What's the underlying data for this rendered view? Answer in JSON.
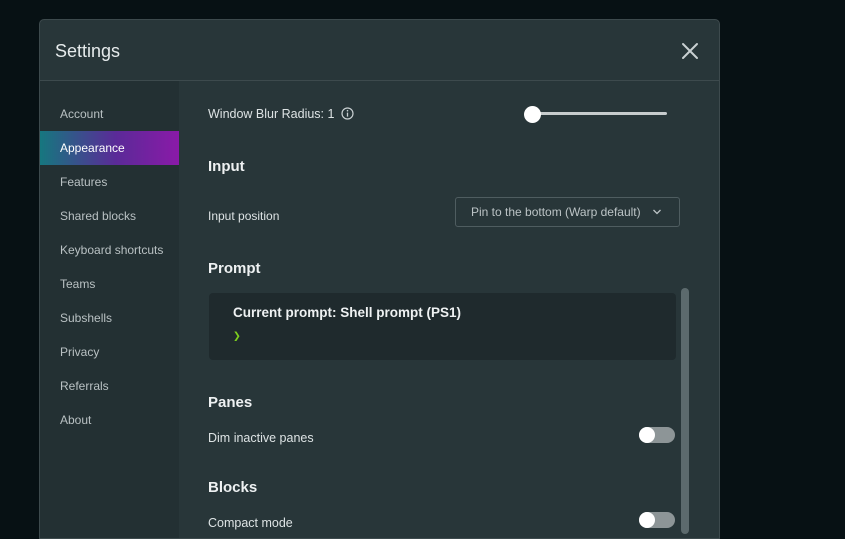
{
  "window": {
    "title": "Settings"
  },
  "sidebar": {
    "items": [
      {
        "label": "Account"
      },
      {
        "label": "Appearance"
      },
      {
        "label": "Features"
      },
      {
        "label": "Shared blocks"
      },
      {
        "label": "Keyboard shortcuts"
      },
      {
        "label": "Teams"
      },
      {
        "label": "Subshells"
      },
      {
        "label": "Privacy"
      },
      {
        "label": "Referrals"
      },
      {
        "label": "About"
      }
    ],
    "active": "Appearance",
    "active_gradient": [
      "#16777f",
      "#8a1aa8"
    ]
  },
  "appearance": {
    "window_blur": {
      "label": "Window Blur Radius: 1",
      "value": 1
    },
    "input": {
      "title": "Input",
      "position_label": "Input position",
      "position_value": "Pin to the bottom (Warp default)"
    },
    "prompt": {
      "title": "Prompt",
      "current": "Current prompt: Shell prompt (PS1)",
      "glyph": "❯",
      "glyph_color": "#7dcf1e"
    },
    "panes": {
      "title": "Panes",
      "dim_label": "Dim inactive panes",
      "dim_enabled": false
    },
    "blocks": {
      "title": "Blocks",
      "compact_label": "Compact mode",
      "compact_enabled": false
    }
  },
  "icons": {
    "close": "close-icon",
    "info": "info-icon",
    "dropdown": "chevron-down-icon"
  }
}
